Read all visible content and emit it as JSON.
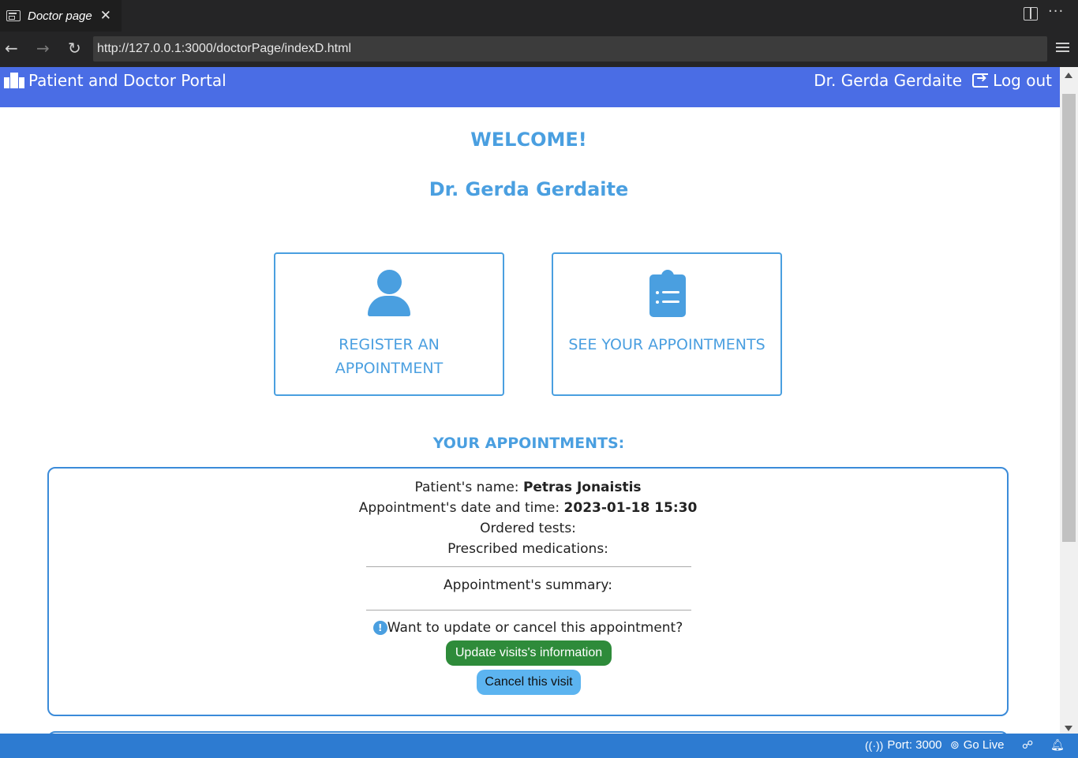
{
  "browser": {
    "tab_title": "Doctor page",
    "tab_close": "✕",
    "url": "http://127.0.0.1:3000/doctorPage/indexD.html",
    "back": "←",
    "forward": "→",
    "reload": "↻",
    "more": "···"
  },
  "header": {
    "brand": "Patient and Doctor Portal",
    "user": "Dr. Gerda Gerdaite",
    "logout": "Log out"
  },
  "welcome": {
    "title": "WELCOME!",
    "name": "Dr. Gerda Gerdaite"
  },
  "cards": [
    {
      "line1": "REGISTER AN",
      "line2": "APPOINTMENT",
      "icon": "person-icon"
    },
    {
      "line1": "SEE YOUR APPOINTMENTS",
      "icon": "clipboard-list-icon"
    }
  ],
  "appointments": {
    "title": "YOUR APPOINTMENTS:",
    "items": [
      {
        "patient_label": "Patient's name:",
        "patient_name": "Petras Jonaistis",
        "datetime_label": "Appointment's date and time:",
        "datetime": "2023-01-18 15:30",
        "tests_label": "Ordered tests:",
        "meds_label": "Prescribed medications:",
        "summary_label": "Appointment's summary:",
        "info_icon": "!",
        "prompt": "Want to update or cancel this appointment?",
        "update_button": "Update visits's information",
        "cancel_button": "Cancel this visit"
      }
    ]
  },
  "statusbar": {
    "port": "Port: 3000",
    "golive": "Go Live"
  },
  "colors": {
    "header_bg": "#4a6de5",
    "accent": "#4a9fe0",
    "update_btn": "#2e8b3a",
    "cancel_btn": "#5cb4f0",
    "statusbar": "#2d7bd1"
  }
}
